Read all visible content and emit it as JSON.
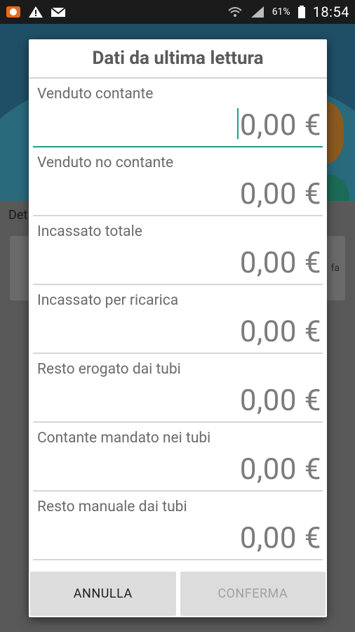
{
  "statusbar": {
    "battery_pct": "61%",
    "time": "18:54"
  },
  "background": {
    "partial_text": "Det",
    "card_right_text": "fa"
  },
  "dialog": {
    "title": "Dati da ultima lettura",
    "fields": [
      {
        "label": "Venduto contante",
        "value": "0,00 €"
      },
      {
        "label": "Venduto no contante",
        "value": "0,00 €"
      },
      {
        "label": "Incassato totale",
        "value": "0,00 €"
      },
      {
        "label": "Incassato per ricarica",
        "value": "0,00 €"
      },
      {
        "label": "Resto erogato dai tubi",
        "value": "0,00 €"
      },
      {
        "label": "Contante mandato nei tubi",
        "value": "0,00 €"
      },
      {
        "label": "Resto manuale dai tubi",
        "value": "0,00 €"
      }
    ],
    "buttons": {
      "cancel": "ANNULLA",
      "confirm": "CONFERMA"
    }
  }
}
